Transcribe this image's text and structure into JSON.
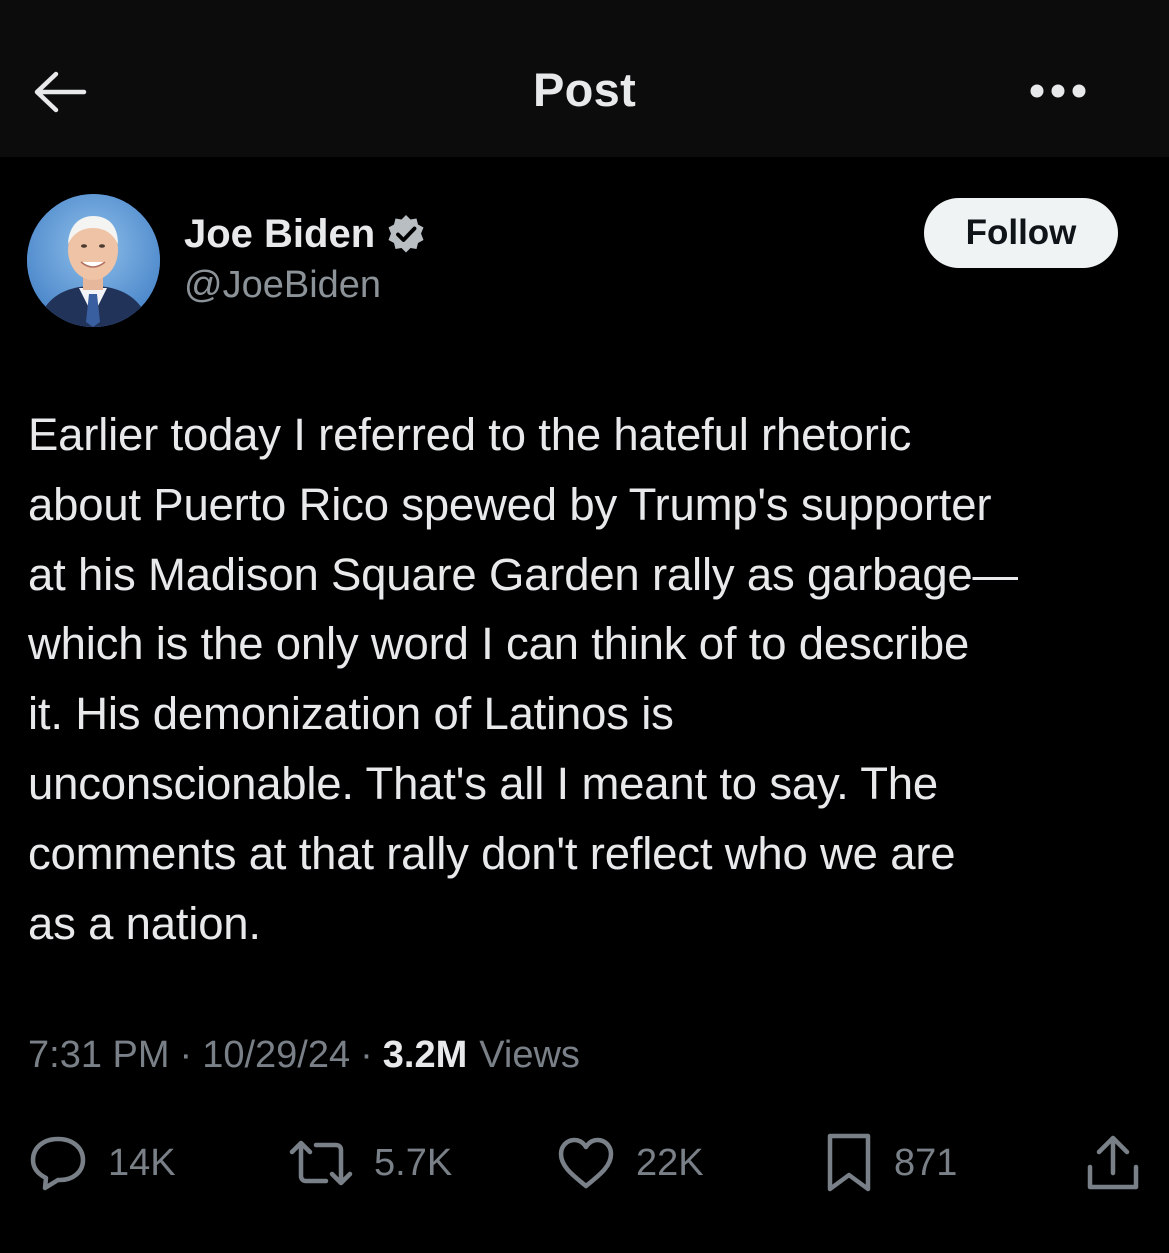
{
  "header": {
    "title": "Post"
  },
  "author": {
    "display_name": "Joe Biden",
    "handle": "@JoeBiden",
    "verified": true,
    "follow_label": "Follow"
  },
  "post": {
    "text": "Earlier today I referred to the hateful rhetoric\nabout Puerto Rico spewed by Trump's supporter\nat his Madison Square Garden rally as garbage—\nwhich is the only word I can think of to describe\nit. His demonization of Latinos is\nunconscionable. That's all I meant to say. The\ncomments at that rally don't reflect who we are\nas a nation."
  },
  "meta": {
    "time": "7:31 PM",
    "separator": "·",
    "date": "10/29/24",
    "views_count": "3.2M",
    "views_label": "Views"
  },
  "actions": {
    "replies": "14K",
    "reposts": "5.7K",
    "likes": "22K",
    "bookmarks": "871"
  },
  "icons": {
    "back": "back-arrow-icon",
    "more": "more-icon",
    "verified": "verified-badge-icon",
    "reply": "reply-icon",
    "repost": "repost-icon",
    "like": "heart-icon",
    "bookmark": "bookmark-icon",
    "share": "share-icon"
  },
  "colors": {
    "background": "#000000",
    "header_background": "#0c0c0c",
    "text": "#e7e9ea",
    "muted": "#7a8087",
    "follow_button": "#eff3f4"
  }
}
